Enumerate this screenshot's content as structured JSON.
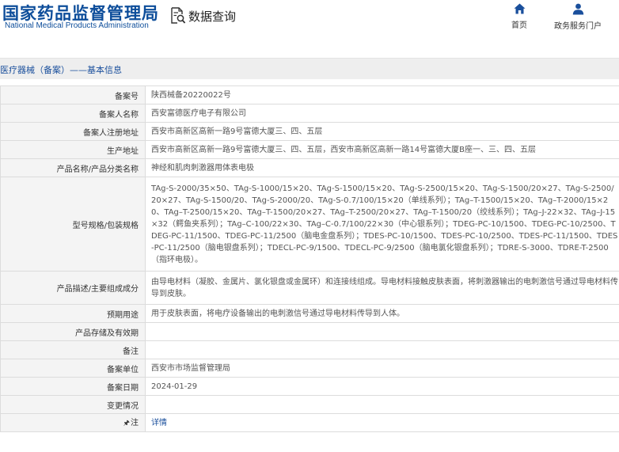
{
  "header": {
    "site_title_cn": "国家药品监督管理局",
    "site_title_en": "National Medical Products Administration",
    "query_label": "数据查询",
    "nav": [
      {
        "label": "首页",
        "icon": "home-icon"
      },
      {
        "label": "政务服务门户",
        "icon": "user-icon"
      }
    ]
  },
  "section": {
    "title": "医疗器械（备案）——基本信息"
  },
  "rows": [
    {
      "label": "备案号",
      "value": "陕西械备20220022号"
    },
    {
      "label": "备案人名称",
      "value": "西安富德医疗电子有限公司"
    },
    {
      "label": "备案人注册地址",
      "value": "西安市高新区高新一路9号富德大厦三、四、五层"
    },
    {
      "label": "生产地址",
      "value": "西安市高新区高新一路9号富德大厦三、四、五层，西安市高新区高新一路14号富德大厦B座一、三、四、五层"
    },
    {
      "label": "产品名称/产品分类名称",
      "value": "神经和肌肉刺激器用体表电极"
    },
    {
      "label": "型号规格/包装规格",
      "value": "TAg-S-2000/35×50、TAg-S-1000/15×20、TAg-S-1500/15×20、TAg-S-2500/15×20、TAg-S-1500/20×27、TAg-S-2500/20×27、TAg-S-1500/20、TAg-S-2000/20、TAg-S-0.7/100/15×20（单线系列）；TAg–T-1500/15×20、TAg–T-2000/15×20、TAg–T-2500/15×20、TAg–T-1500/20×27、TAg–T-2500/20×27、TAg–T-1500/20（绞线系列）；TAg–J-22×32、TAg–J-15×32（鳄鱼夹系列）；TAg–C-100/22×30、TAg–C-0.7/100/22×30（中心银系列）；TDEG-PC-10/1500、TDEG-PC-10/2500、TDEG-PC-11/1500、TDEG-PC-11/2500（脑电金盘系列）；TDES-PC-10/1500、TDES-PC-10/2500、TDES-PC-11/1500、TDES-PC-11/2500（脑电银盘系列）；TDECL-PC-9/1500、TDECL-PC-9/2500（脑电氯化银盘系列）；TDRE-S-3000、TDRE-T-2500（指环电极）。"
    },
    {
      "label": "产品描述/主要组成成分",
      "value": "由导电材料（凝胶、金属片、氯化银盘或金属环）和连接线组成。导电材料接触皮肤表面，将刺激器输出的电刺激信号通过导电材料传导到皮肤。"
    },
    {
      "label": "预期用途",
      "value": "用于皮肤表面，将电疗设备输出的电刺激信号通过导电材料传导到人体。"
    },
    {
      "label": "产品存储及有效期",
      "value": ""
    },
    {
      "label": "备注",
      "value": ""
    },
    {
      "label": "备案单位",
      "value": "西安市市场监督管理局"
    },
    {
      "label": "备案日期",
      "value": "2024-01-29"
    },
    {
      "label": "变更情况",
      "value": ""
    }
  ],
  "note_row": {
    "icon": "pushpin-icon",
    "icon_glyph": "🖈",
    "label": "注",
    "link_text": "详情"
  },
  "colors": {
    "brand_blue": "#0d4d9a",
    "link_blue": "#1a4f9c",
    "label_bg": "#f4f4f4",
    "border": "#dcdcdc",
    "titlebar_bg": "#eeeeee"
  }
}
